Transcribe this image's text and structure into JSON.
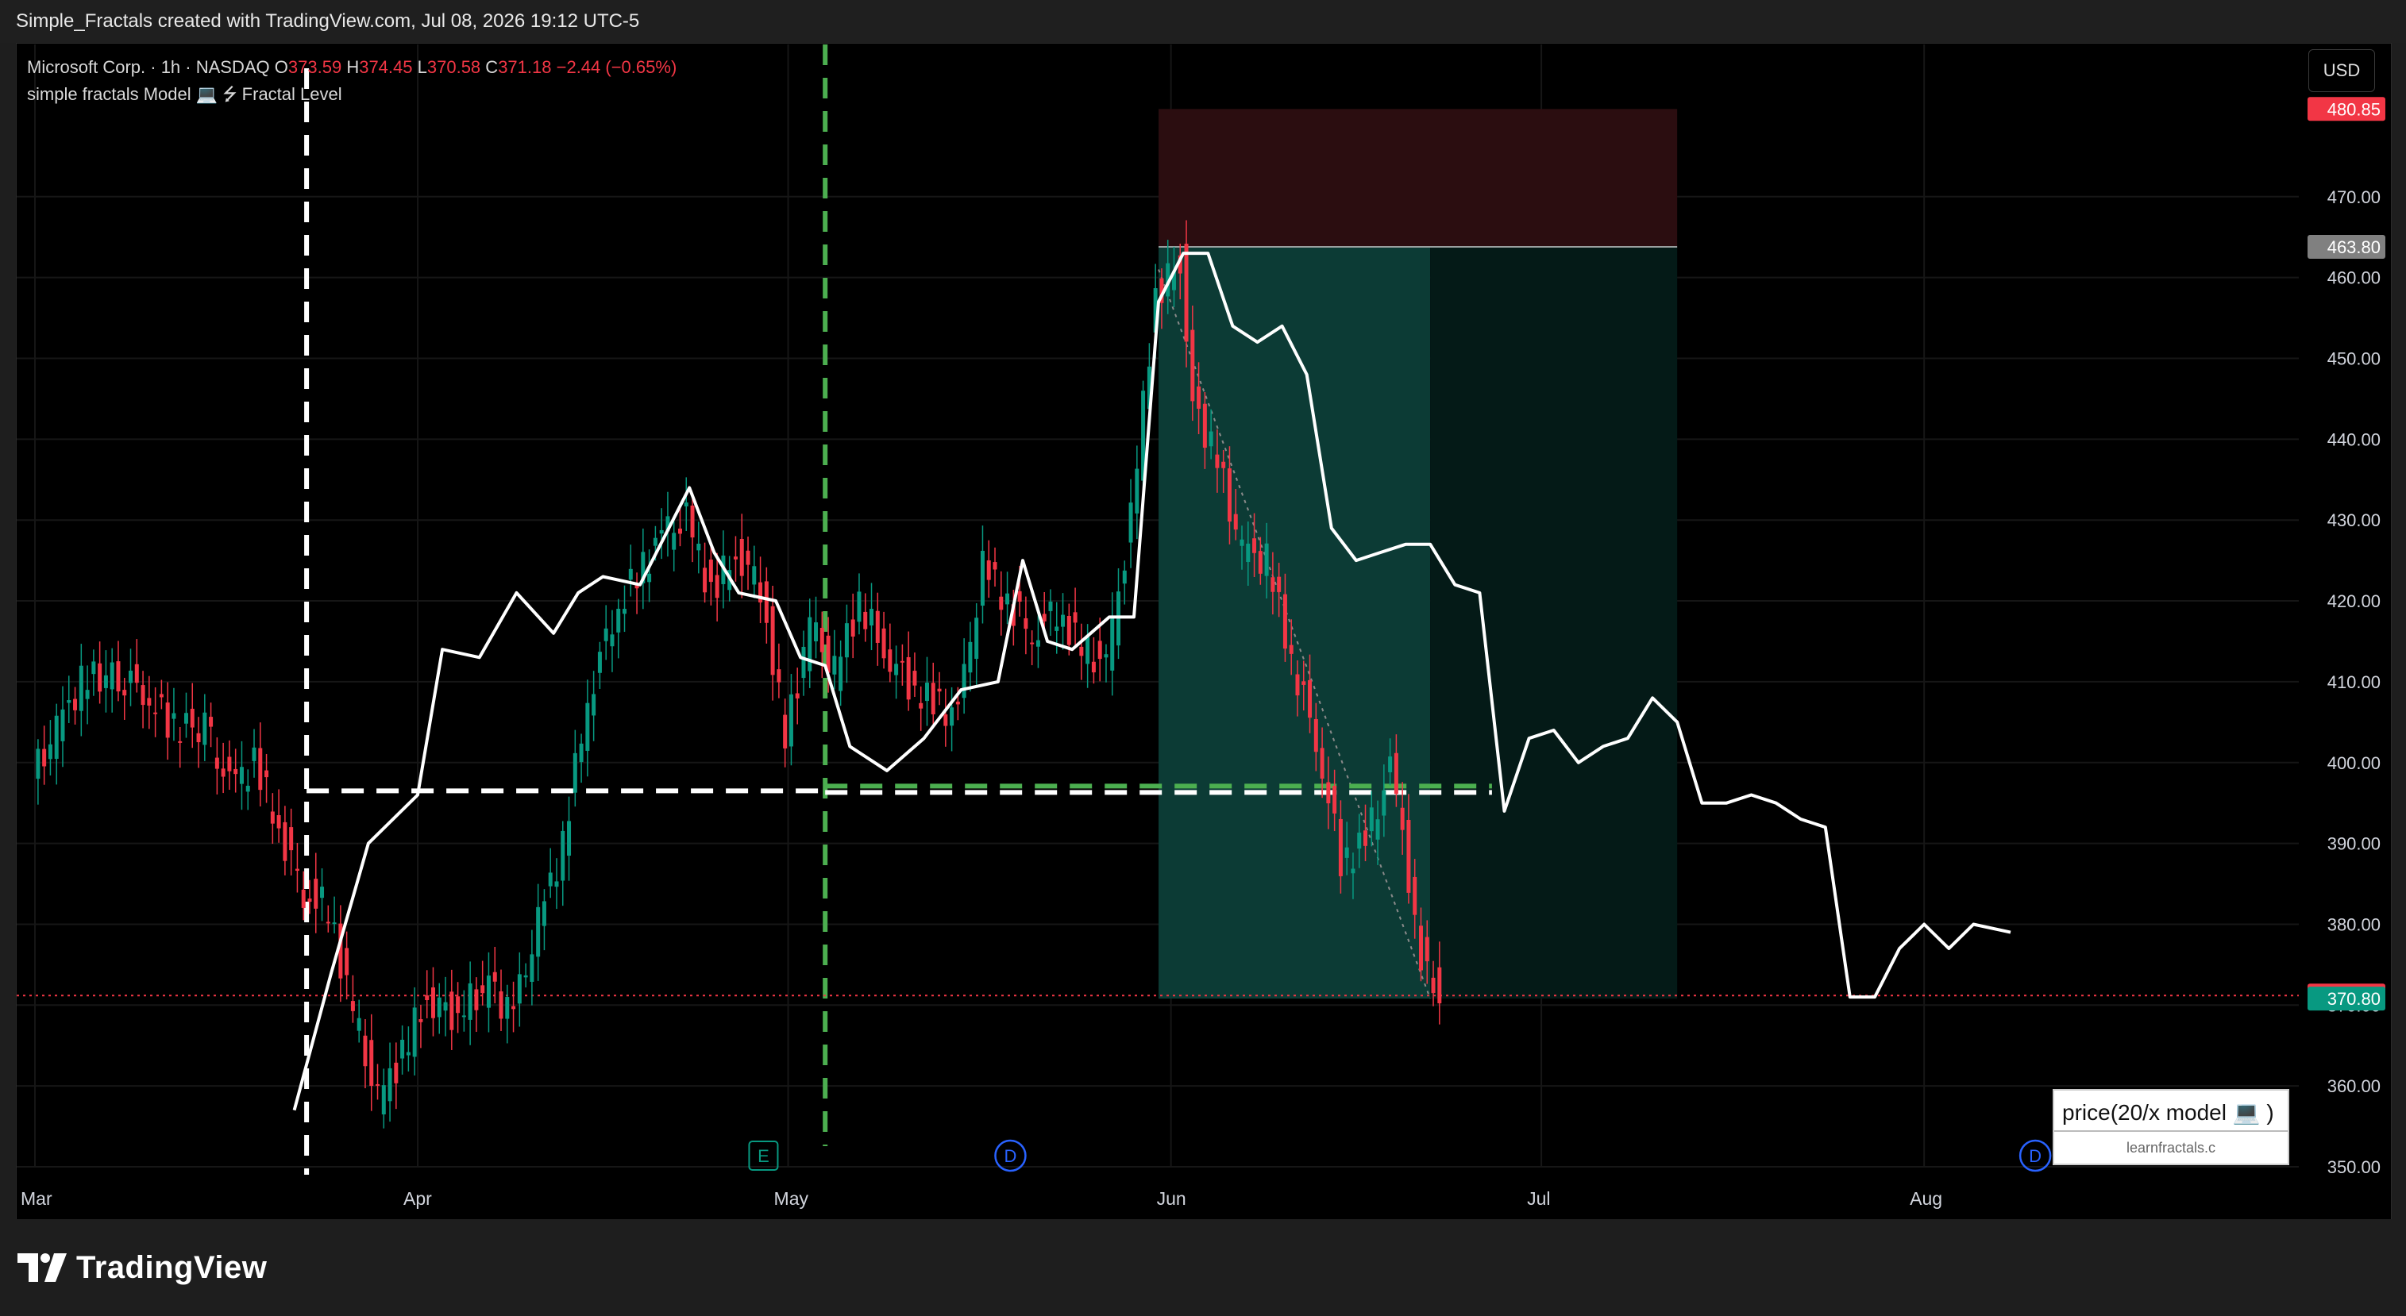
{
  "header": {
    "attribution": "Simple_Fractals created with TradingView.com, Jul 08, 2026 19:12 UTC-5"
  },
  "legend": {
    "symbol": "Microsoft Corp. · 1h · NASDAQ",
    "open_label": "O",
    "open": "373.59",
    "high_label": "H",
    "high": "374.45",
    "low_label": "L",
    "low": "370.58",
    "close_label": "C",
    "close": "371.18",
    "change": "−2.44 (−0.65%)",
    "indicator": "simple fractals Model 💻 ⭍ Fractal Level"
  },
  "currency_button": "USD",
  "logo_text": "TradingView",
  "model_box": {
    "title": "price(20/x model 💻 )",
    "subtitle": "learnfractals.c"
  },
  "markers": {
    "earnings": "E",
    "dividend": "D"
  },
  "colors": {
    "background": "#000000",
    "up_candle": "#089981",
    "down_candle": "#f23645",
    "fractal_line": "#ffffff",
    "green_marker": "#4caf50",
    "target_zone": "#0c3b35",
    "stop_zone": "#2b0d10"
  },
  "chart_data": {
    "type": "line",
    "title": "",
    "xlabel": "",
    "ylabel": "",
    "ylim": [
      347,
      484
    ],
    "x_ticks": [
      "Mar",
      "Apr",
      "May",
      "Jun",
      "Jul",
      "Aug"
    ],
    "y_ticks": [
      "350.00",
      "360.00",
      "370.00",
      "380.00",
      "390.00",
      "400.00",
      "410.00",
      "420.00",
      "430.00",
      "440.00",
      "450.00",
      "460.00",
      "470.00"
    ],
    "price_labels": [
      {
        "text": "480.85",
        "value": 480.85,
        "color": "#f23645"
      },
      {
        "text": "463.80",
        "value": 463.8,
        "color": "#808080"
      },
      {
        "text": "371.18",
        "value": 371.18,
        "color": "#f23645"
      },
      {
        "text": "370.80",
        "value": 370.8,
        "color": "#089981"
      }
    ],
    "levels": {
      "current_price": 371.18,
      "fractal_level": 396.5,
      "stop": 480.85,
      "entry": 463.8,
      "target": 370.8
    },
    "series": [
      {
        "values": [
          {
            "date": "2026-03-22",
            "value": 357
          },
          {
            "date": "2026-03-25",
            "value": 374
          },
          {
            "date": "2026-03-28",
            "value": 390
          },
          {
            "date": "2026-04-01",
            "value": 396
          },
          {
            "date": "2026-04-03",
            "value": 414
          },
          {
            "date": "2026-04-06",
            "value": 413
          },
          {
            "date": "2026-04-09",
            "value": 421
          },
          {
            "date": "2026-04-12",
            "value": 416
          },
          {
            "date": "2026-04-14",
            "value": 421
          },
          {
            "date": "2026-04-16",
            "value": 423
          },
          {
            "date": "2026-04-19",
            "value": 422
          },
          {
            "date": "2026-04-21",
            "value": 428
          },
          {
            "date": "2026-04-23",
            "value": 434
          },
          {
            "date": "2026-04-25",
            "value": 426
          },
          {
            "date": "2026-04-27",
            "value": 421
          },
          {
            "date": "2026-04-30",
            "value": 420
          },
          {
            "date": "2026-05-02",
            "value": 413
          },
          {
            "date": "2026-05-04",
            "value": 412
          },
          {
            "date": "2026-05-06",
            "value": 402
          },
          {
            "date": "2026-05-09",
            "value": 399
          },
          {
            "date": "2026-05-12",
            "value": 403
          },
          {
            "date": "2026-05-15",
            "value": 409
          },
          {
            "date": "2026-05-18",
            "value": 410
          },
          {
            "date": "2026-05-20",
            "value": 425
          },
          {
            "date": "2026-05-22",
            "value": 415
          },
          {
            "date": "2026-05-24",
            "value": 414
          },
          {
            "date": "2026-05-27",
            "value": 418
          },
          {
            "date": "2026-05-29",
            "value": 418
          },
          {
            "date": "2026-05-31",
            "value": 457
          },
          {
            "date": "2026-06-02",
            "value": 463
          },
          {
            "date": "2026-06-04",
            "value": 463
          },
          {
            "date": "2026-06-06",
            "value": 454
          },
          {
            "date": "2026-06-08",
            "value": 452
          },
          {
            "date": "2026-06-10",
            "value": 454
          },
          {
            "date": "2026-06-12",
            "value": 448
          },
          {
            "date": "2026-06-14",
            "value": 429
          },
          {
            "date": "2026-06-16",
            "value": 425
          },
          {
            "date": "2026-06-18",
            "value": 426
          },
          {
            "date": "2026-06-20",
            "value": 427
          },
          {
            "date": "2026-06-22",
            "value": 427
          },
          {
            "date": "2026-06-24",
            "value": 422
          },
          {
            "date": "2026-06-26",
            "value": 421
          },
          {
            "date": "2026-06-28",
            "value": 394
          },
          {
            "date": "2026-06-30",
            "value": 403
          },
          {
            "date": "2026-07-02",
            "value": 404
          },
          {
            "date": "2026-07-04",
            "value": 400
          },
          {
            "date": "2026-07-06",
            "value": 402
          },
          {
            "date": "2026-07-08",
            "value": 403
          },
          {
            "date": "2026-07-10",
            "value": 408
          },
          {
            "date": "2026-07-12",
            "value": 405
          },
          {
            "date": "2026-07-14",
            "value": 395
          },
          {
            "date": "2026-07-16",
            "value": 395
          },
          {
            "date": "2026-07-18",
            "value": 396
          },
          {
            "date": "2026-07-20",
            "value": 395
          },
          {
            "date": "2026-07-22",
            "value": 393
          },
          {
            "date": "2026-07-24",
            "value": 392
          },
          {
            "date": "2026-07-26",
            "value": 371
          },
          {
            "date": "2026-07-28",
            "value": 371
          },
          {
            "date": "2026-07-30",
            "value": 377
          },
          {
            "date": "2026-08-01",
            "value": 380
          },
          {
            "date": "2026-08-03",
            "value": 377
          },
          {
            "date": "2026-08-05",
            "value": 380
          },
          {
            "date": "2026-08-08",
            "value": 379
          }
        ]
      },
      {
        "type": "candlestick",
        "values": [
          {
            "date": "2026-03-01",
            "value": 398
          },
          {
            "date": "2026-03-03",
            "value": 404
          },
          {
            "date": "2026-03-05",
            "value": 410
          },
          {
            "date": "2026-03-08",
            "value": 411
          },
          {
            "date": "2026-03-10",
            "value": 409
          },
          {
            "date": "2026-03-12",
            "value": 405
          },
          {
            "date": "2026-03-15",
            "value": 404
          },
          {
            "date": "2026-03-17",
            "value": 397
          },
          {
            "date": "2026-03-19",
            "value": 400
          },
          {
            "date": "2026-03-21",
            "value": 392
          },
          {
            "date": "2026-03-23",
            "value": 384
          },
          {
            "date": "2026-03-25",
            "value": 382
          },
          {
            "date": "2026-03-27",
            "value": 369
          },
          {
            "date": "2026-03-29",
            "value": 358
          },
          {
            "date": "2026-03-31",
            "value": 364
          },
          {
            "date": "2026-04-02",
            "value": 371
          },
          {
            "date": "2026-04-04",
            "value": 369
          },
          {
            "date": "2026-04-07",
            "value": 372
          },
          {
            "date": "2026-04-09",
            "value": 369
          },
          {
            "date": "2026-04-11",
            "value": 380
          },
          {
            "date": "2026-04-13",
            "value": 390
          },
          {
            "date": "2026-04-15",
            "value": 408
          },
          {
            "date": "2026-04-17",
            "value": 418
          },
          {
            "date": "2026-04-19",
            "value": 423
          },
          {
            "date": "2026-04-21",
            "value": 428
          },
          {
            "date": "2026-04-23",
            "value": 430
          },
          {
            "date": "2026-04-25",
            "value": 421
          },
          {
            "date": "2026-04-27",
            "value": 426
          },
          {
            "date": "2026-04-29",
            "value": 422
          },
          {
            "date": "2026-05-01",
            "value": 403
          },
          {
            "date": "2026-05-03",
            "value": 417
          },
          {
            "date": "2026-05-05",
            "value": 411
          },
          {
            "date": "2026-05-07",
            "value": 420
          },
          {
            "date": "2026-05-09",
            "value": 414
          },
          {
            "date": "2026-05-11",
            "value": 410
          },
          {
            "date": "2026-05-13",
            "value": 407
          },
          {
            "date": "2026-05-15",
            "value": 406
          },
          {
            "date": "2026-05-17",
            "value": 424
          },
          {
            "date": "2026-05-19",
            "value": 420
          },
          {
            "date": "2026-05-21",
            "value": 416
          },
          {
            "date": "2026-05-23",
            "value": 419
          },
          {
            "date": "2026-05-25",
            "value": 414
          },
          {
            "date": "2026-05-27",
            "value": 412
          },
          {
            "date": "2026-05-29",
            "value": 430
          },
          {
            "date": "2026-05-31",
            "value": 458
          },
          {
            "date": "2026-06-02",
            "value": 462
          },
          {
            "date": "2026-06-03",
            "value": 445
          },
          {
            "date": "2026-06-05",
            "value": 437
          },
          {
            "date": "2026-06-07",
            "value": 426
          },
          {
            "date": "2026-06-09",
            "value": 425
          },
          {
            "date": "2026-06-11",
            "value": 413
          },
          {
            "date": "2026-06-13",
            "value": 403
          },
          {
            "date": "2026-06-15",
            "value": 388
          },
          {
            "date": "2026-06-17",
            "value": 390
          },
          {
            "date": "2026-06-19",
            "value": 399
          },
          {
            "date": "2026-06-20",
            "value": 391
          },
          {
            "date": "2026-06-21",
            "value": 379
          },
          {
            "date": "2026-06-22",
            "value": 374
          },
          {
            "date": "2026-06-23",
            "value": 371
          }
        ]
      }
    ]
  }
}
